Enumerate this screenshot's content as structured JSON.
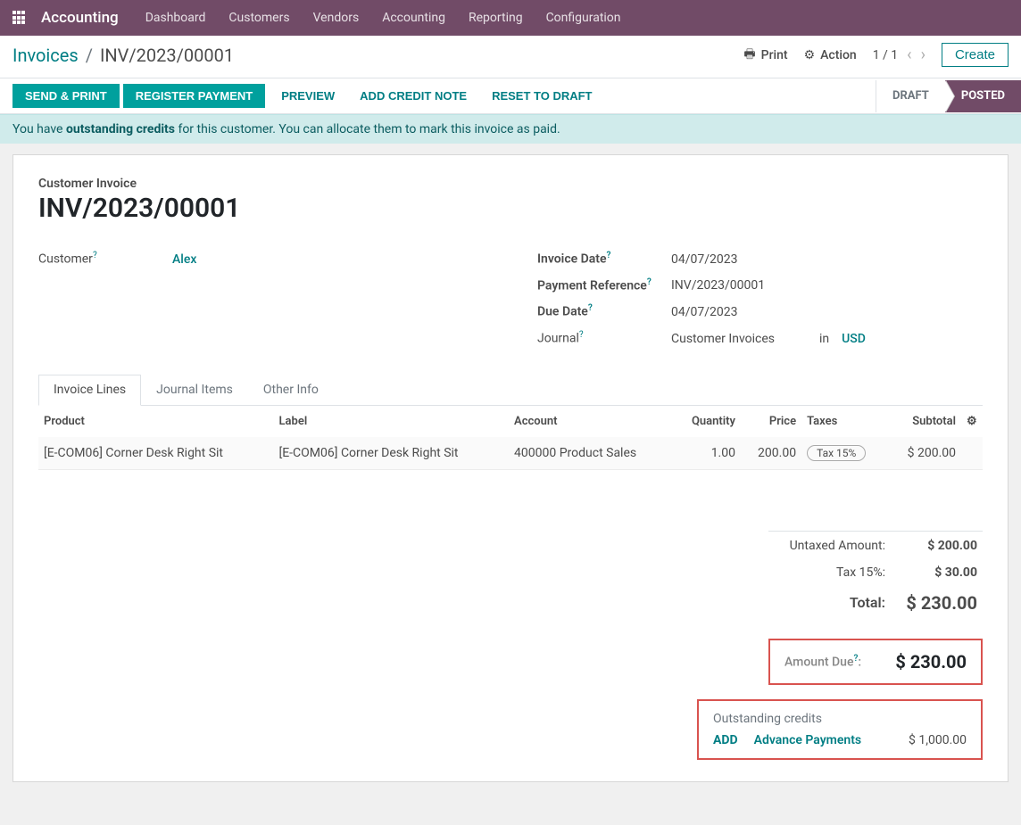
{
  "brand": "Accounting",
  "menu": [
    "Dashboard",
    "Customers",
    "Vendors",
    "Accounting",
    "Reporting",
    "Configuration"
  ],
  "breadcrumb": {
    "root": "Invoices",
    "sep": "/",
    "current": "INV/2023/00001"
  },
  "control": {
    "print": "Print",
    "action": "Action",
    "pager": "1 / 1",
    "create": "Create"
  },
  "buttons": {
    "send_print": "SEND & PRINT",
    "register": "REGISTER PAYMENT",
    "preview": "PREVIEW",
    "credit_note": "ADD CREDIT NOTE",
    "reset": "RESET TO DRAFT"
  },
  "status": {
    "draft": "DRAFT",
    "posted": "POSTED"
  },
  "banner": {
    "pre": "You have ",
    "bold": "outstanding credits",
    "post": " for this customer. You can allocate them to mark this invoice as paid."
  },
  "form": {
    "section_label": "Customer Invoice",
    "id": "INV/2023/00001",
    "customer_label": "Customer",
    "customer": "Alex",
    "invoice_date_label": "Invoice Date",
    "invoice_date": "04/07/2023",
    "payment_ref_label": "Payment Reference",
    "payment_ref": "INV/2023/00001",
    "due_date_label": "Due Date",
    "due_date": "04/07/2023",
    "journal_label": "Journal",
    "journal": "Customer Invoices",
    "in": "in",
    "currency": "USD"
  },
  "tabs": [
    "Invoice Lines",
    "Journal Items",
    "Other Info"
  ],
  "line_headers": {
    "product": "Product",
    "label": "Label",
    "account": "Account",
    "quantity": "Quantity",
    "price": "Price",
    "taxes": "Taxes",
    "subtotal": "Subtotal"
  },
  "lines": [
    {
      "product": "[E-COM06] Corner Desk Right Sit",
      "label": "[E-COM06] Corner Desk Right Sit",
      "account": "400000 Product Sales",
      "qty": "1.00",
      "price": "200.00",
      "tax": "Tax 15%",
      "subtotal": "$ 200.00"
    }
  ],
  "totals": {
    "untaxed_label": "Untaxed Amount:",
    "untaxed": "$ 200.00",
    "tax_label": "Tax 15%:",
    "tax": "$ 30.00",
    "total_label": "Total:",
    "total": "$ 230.00"
  },
  "due": {
    "label": "Amount Due",
    "colon": ":",
    "value": "$ 230.00"
  },
  "credits": {
    "title": "Outstanding credits",
    "add": "ADD",
    "source": "Advance Payments",
    "amount": "$ 1,000.00"
  },
  "q": "?"
}
